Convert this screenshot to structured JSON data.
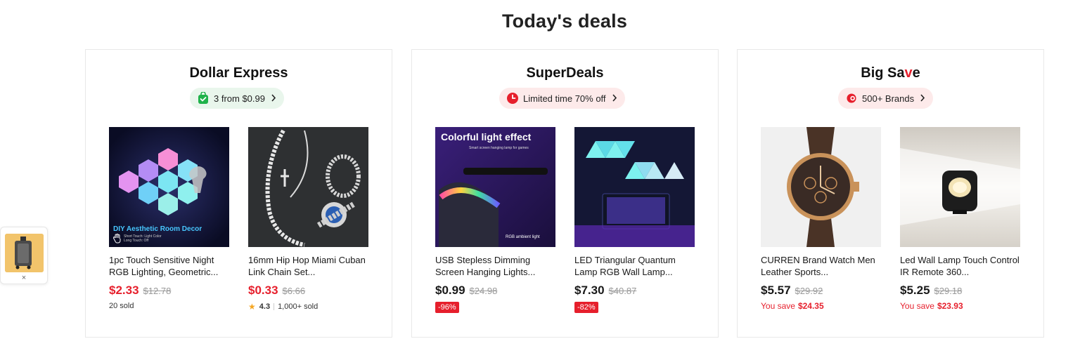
{
  "title": "Today's deals",
  "cards": [
    {
      "title": "Dollar Express",
      "pill": {
        "label": "3 from $0.99",
        "icon": "shopping-bag-icon",
        "bg": "#e9f6ec"
      },
      "products": [
        {
          "name": "1pc Touch Sensitive Night RGB Lighting, Geometric...",
          "price": "$2.33",
          "old_price": "$12.78",
          "sold": "20 sold",
          "image_caption": "DIY Aesthetic Room Decor",
          "image_note1": "Short Touch: Light Color",
          "image_note2": "Long Touch: Off"
        },
        {
          "name": "16mm Hip Hop Miami Cuban Link Chain Set...",
          "price": "$0.33",
          "old_price": "$6.66",
          "rating": "4.3",
          "sold": "1,000+ sold"
        }
      ]
    },
    {
      "title": "SuperDeals",
      "pill": {
        "label": "Limited time 70% off",
        "icon": "clock-icon",
        "bg": "#fdeaea"
      },
      "products": [
        {
          "name": "USB Stepless Dimming Screen Hanging Lights...",
          "price": "$0.99",
          "old_price": "$24.98",
          "discount": "-96%",
          "image_heading": "Colorful light effect",
          "image_sub": "Smart screen hanging lamp for games",
          "image_tag": "RGB ambient light"
        },
        {
          "name": "LED Triangular Quantum Lamp RGB Wall Lamp...",
          "price": "$7.30",
          "old_price": "$40.87",
          "discount": "-82%"
        }
      ]
    },
    {
      "title_prefix": "Big Sa",
      "title_accent": "v",
      "title_suffix": "e",
      "pill": {
        "label": "500+ Brands",
        "icon": "brand-tag-icon",
        "bg": "#fdeaea"
      },
      "products": [
        {
          "name": "CURREN Brand Watch Men Leather Sports...",
          "price": "$5.57",
          "old_price": "$29.92",
          "save_label": "You save",
          "save_amount": "$24.35"
        },
        {
          "name": "Led Wall Lamp Touch Control IR Remote 360...",
          "price": "$5.25",
          "old_price": "$29.18",
          "save_label": "You save",
          "save_amount": "$23.93"
        }
      ]
    }
  ],
  "floating": {
    "close": "×"
  },
  "colors": {
    "accent": "#e61f2c",
    "green_pill": "#e9f6ec",
    "red_pill": "#fdeaea"
  }
}
